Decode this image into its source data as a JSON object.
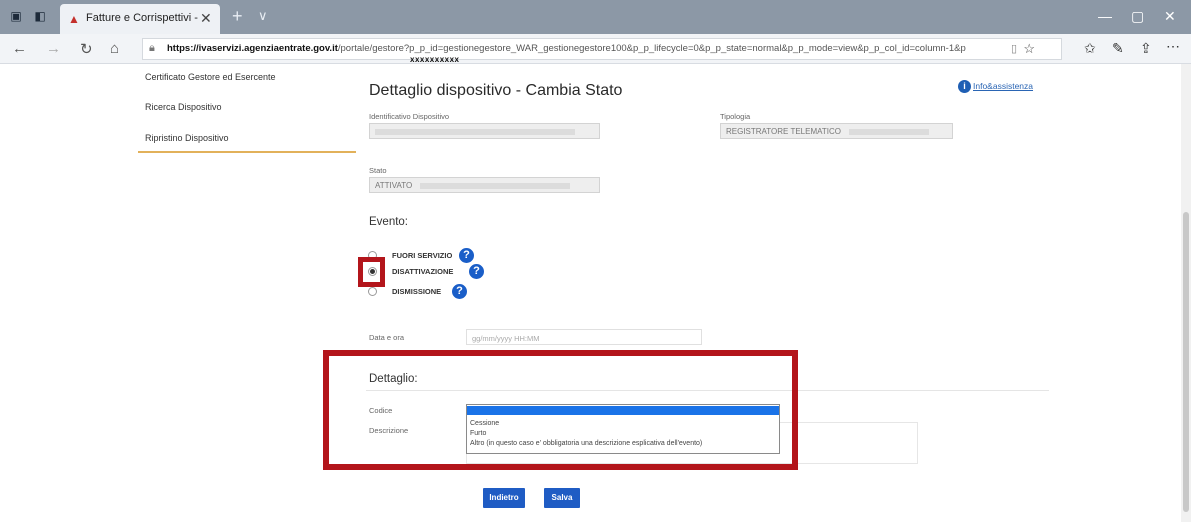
{
  "browser": {
    "tab_title": "Fatture e Corrispettivi -",
    "tab_close": "✕",
    "new_tab": "+",
    "url_host": "https://ivaservizi.agenziaentrate.gov.it",
    "url_path": "/portale/gestore?p_p_id=gestionegestore_WAR_gestionegestore100&p_p_lifecycle=0&p_p_state=normal&p_p_mode=view&p_p_col_id=column-1&p",
    "redacted": "xxxxxxxxxx"
  },
  "sidebar": {
    "items": [
      {
        "label": "Certificato Gestore ed Esercente"
      },
      {
        "label": "Ricerca Dispositivo"
      },
      {
        "label": "Ripristino Dispositivo"
      }
    ]
  },
  "main": {
    "title": "Dettaglio dispositivo - Cambia Stato",
    "help_link": "Info&assistenza",
    "identificativo_label": "Identificativo Dispositivo",
    "tipologia_label": "Tipologia",
    "tipologia_value": "REGISTRATORE TELEMATICO",
    "stato_label": "Stato",
    "stato_value": "ATTIVATO",
    "evento_title": "Evento:",
    "radios": [
      {
        "label": "FUORI SERVIZIO",
        "checked": false
      },
      {
        "label": "DISATTIVAZIONE",
        "checked": true
      },
      {
        "label": "DISMISSIONE",
        "checked": false
      }
    ],
    "data_ora_label": "Data e ora",
    "data_ora_placeholder": "gg/mm/yyyy HH:MM",
    "dettaglio_title": "Dettaglio:",
    "codice_label": "Codice",
    "descrizione_label": "Descrizione",
    "codice_options": [
      "",
      "Cessione",
      "Furto",
      "Altro (in questo caso e' obbligatoria una descrizione esplicativa dell'evento)"
    ],
    "btn_back": "Indietro",
    "btn_save": "Salva"
  },
  "colors": {
    "highlight": "#b3151b",
    "primary_button": "#1f5cc4",
    "sidebar_accent": "#e2b15a"
  }
}
